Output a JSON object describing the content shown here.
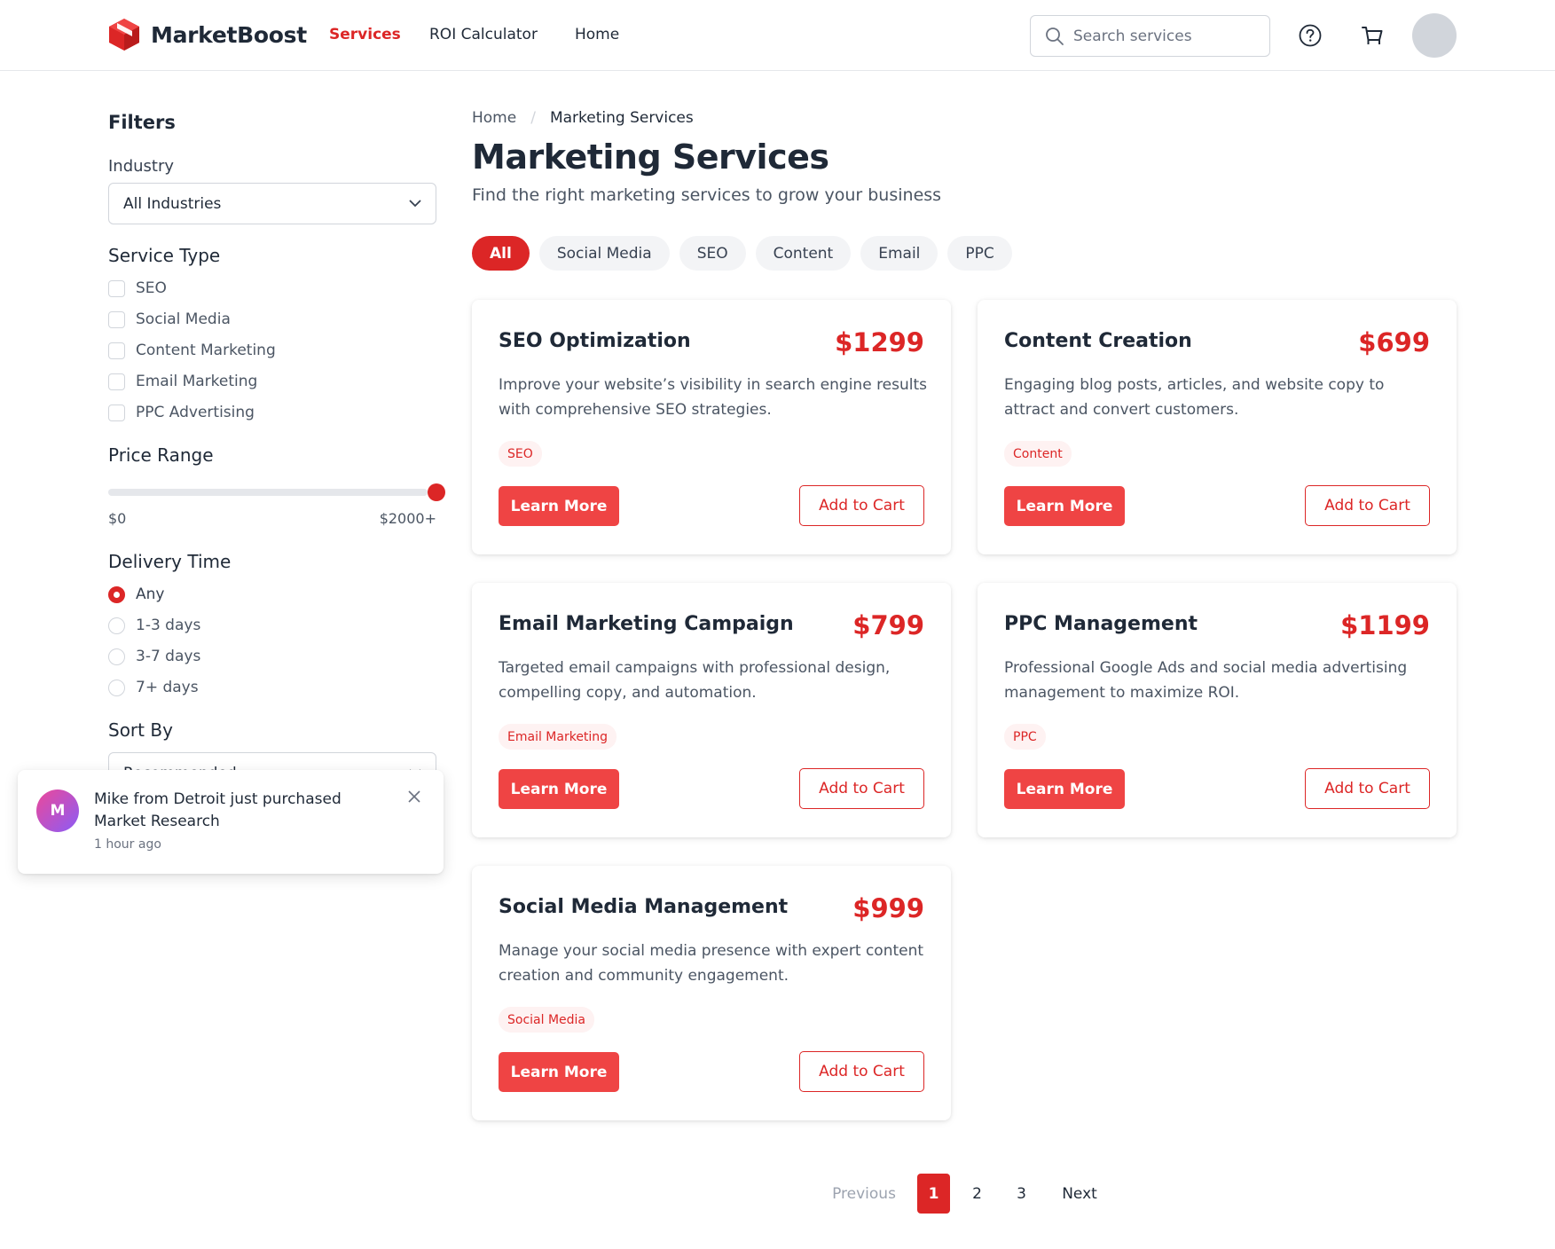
{
  "header": {
    "brand": "MarketBoost",
    "nav": [
      {
        "label": "Services",
        "active": true
      },
      {
        "label": "ROI Calculator",
        "active": false
      },
      {
        "label": "Home",
        "active": false
      }
    ],
    "search_placeholder": "Search services",
    "icons": [
      "help-icon",
      "cart-icon",
      "user-avatar"
    ]
  },
  "filters": {
    "title": "Filters",
    "industry": {
      "label": "Industry",
      "selected": "All Industries"
    },
    "service_type": {
      "label": "Service Type",
      "options": [
        "SEO",
        "Social Media",
        "Content Marketing",
        "Email Marketing",
        "PPC Advertising"
      ]
    },
    "price_range": {
      "label": "Price Range",
      "min": "$0",
      "max": "$2000+",
      "value_fraction": 1.0
    },
    "delivery_time": {
      "label": "Delivery Time",
      "options": [
        "Any",
        "1-3 days",
        "3-7 days",
        "7+ days"
      ],
      "selected": "Any"
    },
    "sort_by": {
      "label": "Sort By",
      "selected": "Recommended"
    }
  },
  "toast": {
    "avatar_initial": "M",
    "message": "Mike from Detroit just purchased Market Research",
    "time": "1 hour ago"
  },
  "main": {
    "breadcrumb": [
      "Home",
      "Marketing Services"
    ],
    "title": "Marketing Services",
    "subtitle": "Find the right marketing services to grow your business",
    "chips": [
      "All",
      "Social Media",
      "SEO",
      "Content",
      "Email",
      "PPC"
    ],
    "active_chip": "All",
    "learn_label": "Learn More",
    "cart_label": "Add to Cart",
    "cards": [
      {
        "title": "SEO Optimization",
        "price": "$1299",
        "description": "Improve your website’s visibility in search engine results with comprehensive SEO strategies.",
        "tag": "SEO"
      },
      {
        "title": "Content Creation",
        "price": "$699",
        "description": "Engaging blog posts, articles, and website copy to attract and convert customers.",
        "tag": "Content"
      },
      {
        "title": "Email Marketing Campaign",
        "price": "$799",
        "description": "Targeted email campaigns with professional design, compelling copy, and automation.",
        "tag": "Email Marketing"
      },
      {
        "title": "PPC Management",
        "price": "$1199",
        "description": "Professional Google Ads and social media advertising management to maximize ROI.",
        "tag": "PPC"
      },
      {
        "title": "Social Media Management",
        "price": "$999",
        "description": "Manage your social media presence with expert content creation and community engagement.",
        "tag": "Social Media"
      }
    ]
  },
  "pagination": {
    "previous": "Previous",
    "pages": [
      "1",
      "2",
      "3"
    ],
    "current": "1",
    "next": "Next"
  },
  "colors": {
    "accent": "#dc2626",
    "button": "#ef4444",
    "tag_bg": "#fef2f2",
    "chip_bg": "#f3f4f6"
  }
}
